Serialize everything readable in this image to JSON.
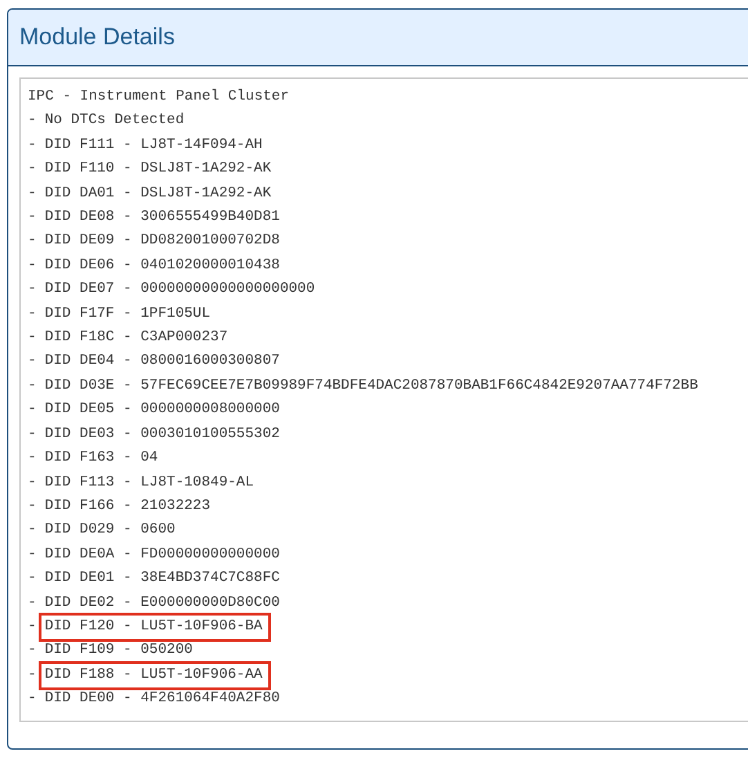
{
  "panel": {
    "title": "Module Details"
  },
  "lines": [
    {
      "text": "IPC - Instrument Panel Cluster",
      "highlighted": false
    },
    {
      "marker": "-",
      "text": "No DTCs Detected",
      "highlighted": false
    },
    {
      "marker": "-",
      "text": "DID F111 - LJ8T-14F094-AH",
      "highlighted": false
    },
    {
      "marker": "-",
      "text": "DID F110 - DSLJ8T-1A292-AK",
      "highlighted": false
    },
    {
      "marker": "-",
      "text": "DID DA01 - DSLJ8T-1A292-AK",
      "highlighted": false
    },
    {
      "marker": "-",
      "text": "DID DE08 - 3006555499B40D81",
      "highlighted": false
    },
    {
      "marker": "-",
      "text": "DID DE09 - DD082001000702D8",
      "highlighted": false
    },
    {
      "marker": "-",
      "text": "DID DE06 - 0401020000010438",
      "highlighted": false
    },
    {
      "marker": "-",
      "text": "DID DE07 - 00000000000000000000",
      "highlighted": false
    },
    {
      "marker": "-",
      "text": "DID F17F - 1PF105UL",
      "highlighted": false
    },
    {
      "marker": "-",
      "text": "DID F18C - C3AP000237",
      "highlighted": false
    },
    {
      "marker": "-",
      "text": "DID DE04 - 0800016000300807",
      "highlighted": false
    },
    {
      "marker": "-",
      "text": "DID D03E - 57FEC69CEE7E7B09989F74BDFE4DAC2087870BAB1F66C4842E9207AA774F72BB",
      "highlighted": false
    },
    {
      "marker": "-",
      "text": "DID DE05 - 0000000008000000",
      "highlighted": false
    },
    {
      "marker": "-",
      "text": "DID DE03 - 0003010100555302",
      "highlighted": false
    },
    {
      "marker": "-",
      "text": "DID F163 - 04",
      "highlighted": false
    },
    {
      "marker": "-",
      "text": "DID F113 - LJ8T-10849-AL",
      "highlighted": false
    },
    {
      "marker": "-",
      "text": "DID F166 - 21032223",
      "highlighted": false
    },
    {
      "marker": "-",
      "text": "DID D029 - 0600",
      "highlighted": false
    },
    {
      "marker": "-",
      "text": "DID DE0A - FD00000000000000",
      "highlighted": false
    },
    {
      "marker": "-",
      "text": "DID DE01 - 38E4BD374C7C88FC",
      "highlighted": false
    },
    {
      "marker": "-",
      "text": "DID DE02 - E000000000D80C00",
      "highlighted": false
    },
    {
      "marker": "-",
      "text": "DID F120 - LU5T-10F906-BA",
      "highlighted": true
    },
    {
      "marker": "-",
      "text": "DID F109 - 050200",
      "highlighted": false
    },
    {
      "marker": "-",
      "text": "DID F188 - LU5T-10F906-AA",
      "highlighted": true
    },
    {
      "marker": "-",
      "text": "DID DE00 - 4F261064F40A2F80",
      "highlighted": false
    }
  ]
}
